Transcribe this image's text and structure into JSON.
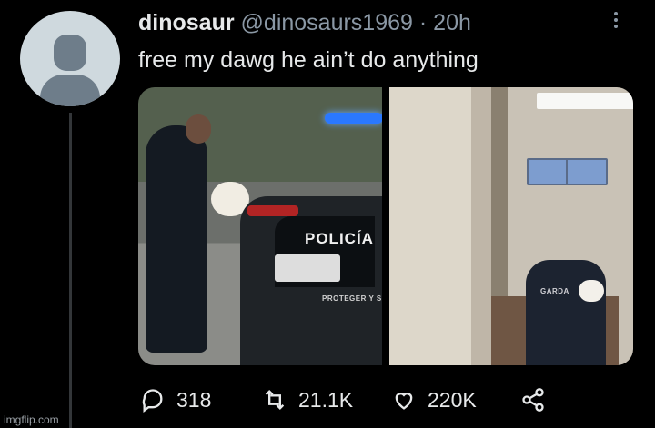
{
  "tweet": {
    "display_name": "dinosaur",
    "handle": "@dinosaurs1969",
    "separator": "·",
    "time": "20h",
    "text": "free my dawg he ain’t do anything"
  },
  "media": {
    "left_photo": {
      "car_label": "POLICÍA",
      "car_subtext": "PROTEGER Y S"
    },
    "right_photo": {
      "jacket_label": "GARDA"
    }
  },
  "actions": {
    "replies": "318",
    "retweets": "21.1K",
    "likes": "220K"
  },
  "watermark": "imgflip.com",
  "colors": {
    "background": "#000000",
    "text": "#e7e9ea",
    "muted": "#8b98a5"
  },
  "icons": {
    "avatar": "default-avatar-icon",
    "more": "more-options-icon",
    "reply": "reply-icon",
    "retweet": "retweet-icon",
    "like": "heart-icon",
    "share": "share-icon"
  }
}
